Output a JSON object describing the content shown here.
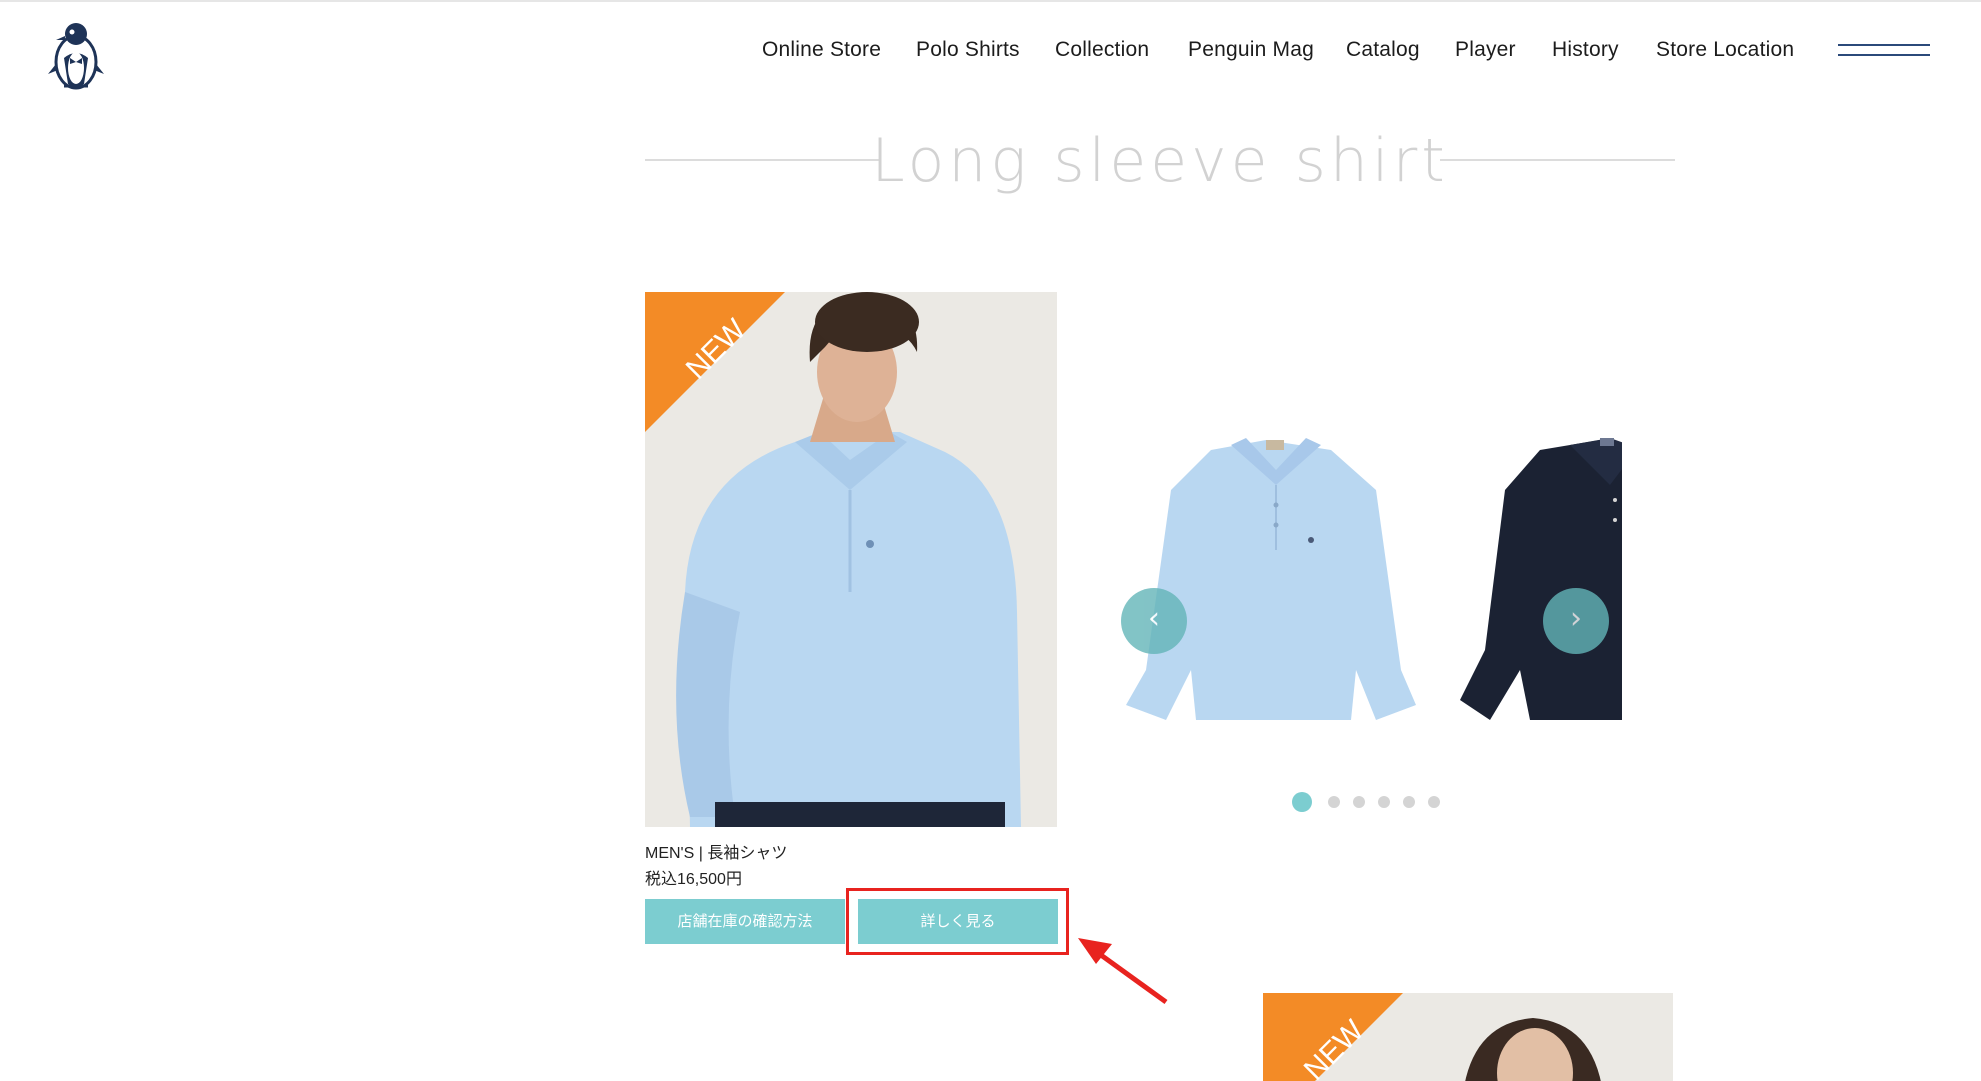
{
  "nav": {
    "items": [
      "Online Store",
      "Polo Shirts",
      "Collection",
      "Penguin Mag",
      "Catalog",
      "Player",
      "History",
      "Store Location"
    ]
  },
  "section": {
    "title": "Long sleeve shirt"
  },
  "product": {
    "badge": "NEW",
    "name": "MEN'S | 長袖シャツ",
    "price": "税込16,500円",
    "stock_button": "店舗在庫の確認方法",
    "detail_button": "詳しく見る"
  },
  "carousel": {
    "prev_icon": "chevron-left-icon",
    "next_icon": "chevron-right-icon",
    "prev_glyph": "‹",
    "next_glyph": "›",
    "dot_count": 6,
    "active_dot": 1
  },
  "second_product": {
    "badge": "NEW"
  },
  "colors": {
    "accent": "#7ccdd0",
    "badge": "#f38b26",
    "nav_text": "#1c1c1c",
    "highlight": "#e8231f",
    "shirt_light_blue": "#b9d7f1",
    "shirt_navy": "#1b2233"
  }
}
